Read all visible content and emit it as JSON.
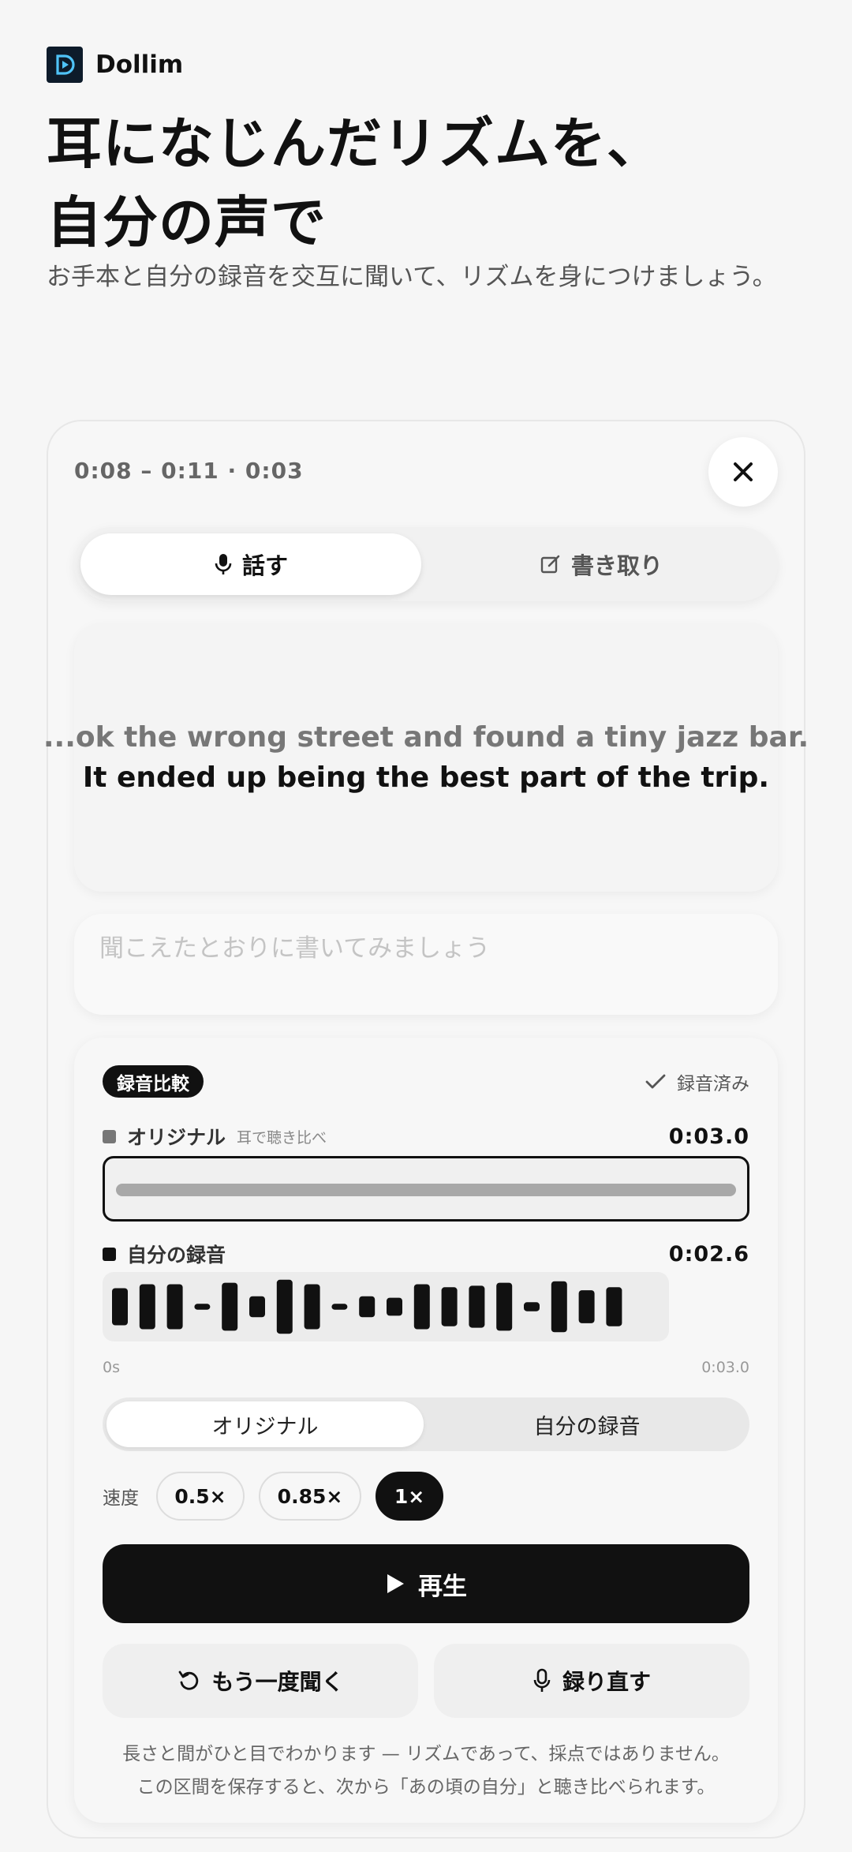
{
  "brand": {
    "name": "Dollim",
    "logo_icon": "play-d-logo-icon"
  },
  "hero": {
    "title_line1": "耳になじんだリズムを、",
    "title_line2": "自分の声で",
    "subtitle": "お手本と自分の録音を交互に聞いて、リズムを身につけましょう。"
  },
  "segment": {
    "timecode": "0:08 – 0:11 · 0:03",
    "close_icon": "close-icon"
  },
  "mode_tabs": [
    {
      "label": "話す",
      "icon": "microphone-icon",
      "active": true
    },
    {
      "label": "書き取り",
      "icon": "pencil-edit-icon",
      "active": false
    }
  ],
  "sentence": {
    "previous": "...ok the wrong street and found a tiny jazz bar.",
    "current": "It ended up being the best part of the trip."
  },
  "dictation": {
    "placeholder": "聞こえたとおりに書いてみましょう",
    "value": ""
  },
  "compare": {
    "badge": "録音比較",
    "recorded_label": "録音済み",
    "original": {
      "label": "オリジナル",
      "hint": "耳で聴き比べ",
      "duration": "0:03.0",
      "progress": 1.0
    },
    "mine": {
      "label": "自分の録音",
      "duration": "0:02.6"
    },
    "axis_start": "0s",
    "axis_end": "0:03.0",
    "waveform_levels": [
      0.62,
      0.75,
      0.75,
      0.1,
      0.8,
      0.35,
      0.9,
      0.75,
      0.1,
      0.35,
      0.3,
      0.75,
      0.65,
      0.7,
      0.8,
      0.15,
      0.85,
      0.55,
      0.65
    ],
    "source_options": [
      "オリジナル",
      "自分の録音"
    ],
    "source_selected": 0,
    "speed_label": "速度",
    "speeds": [
      "0.5×",
      "0.85×",
      "1×"
    ],
    "speed_selected": 2,
    "play_label": "再生",
    "replay_label": "もう一度聞く",
    "rerecord_label": "録り直す",
    "note_line1": "長さと間がひと目でわかります — リズムであって、採点ではありません。",
    "note_line2": "この区間を保存すると、次から「あの頃の自分」と聴き比べられます。"
  }
}
